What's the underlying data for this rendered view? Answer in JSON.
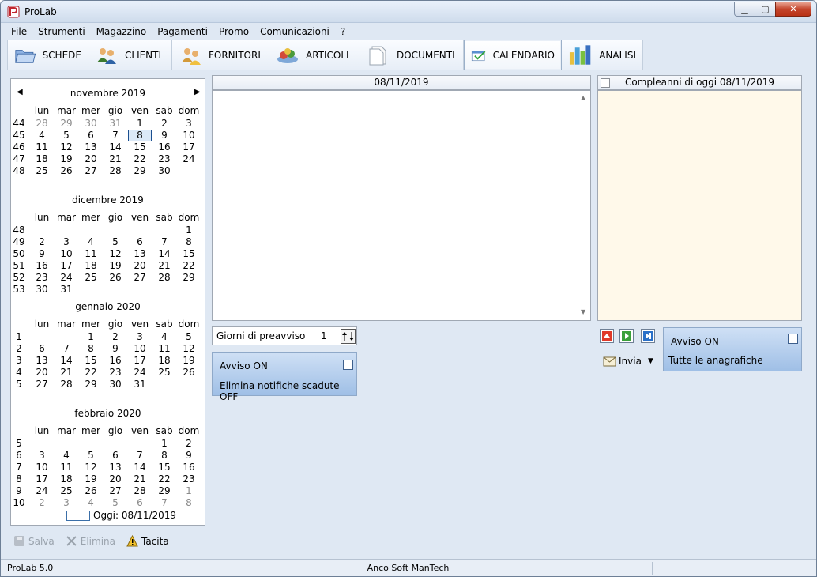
{
  "window": {
    "title": "ProLab"
  },
  "menu": [
    {
      "label": "File"
    },
    {
      "label": "Strumenti"
    },
    {
      "label": "Magazzino"
    },
    {
      "label": "Pagamenti"
    },
    {
      "label": "Promo"
    },
    {
      "label": "Comunicazioni"
    },
    {
      "label": "?"
    }
  ],
  "toolbar": [
    {
      "label": "SCHEDE",
      "icon": "folder-icon"
    },
    {
      "label": "CLIENTI",
      "icon": "customers-icon"
    },
    {
      "label": "FORNITORI",
      "icon": "suppliers-icon"
    },
    {
      "label": "ARTICOLI",
      "icon": "articles-icon"
    },
    {
      "label": "DOCUMENTI",
      "icon": "documents-icon"
    },
    {
      "label": "CALENDARIO",
      "icon": "calendar-check-icon",
      "active": true
    },
    {
      "label": "ANALISI",
      "icon": "bar-chart-icon"
    }
  ],
  "calendar": {
    "dow": [
      "lun",
      "mar",
      "mer",
      "gio",
      "ven",
      "sab",
      "dom"
    ],
    "selected": "8",
    "months": [
      {
        "title": "novembre 2019",
        "weeks": [
          {
            "wk": "44",
            "days": [
              [
                "28",
                1
              ],
              [
                "29",
                1
              ],
              [
                "30",
                1
              ],
              [
                "31",
                1
              ],
              [
                "1",
                0
              ],
              [
                "2",
                0
              ],
              [
                "3",
                0
              ]
            ]
          },
          {
            "wk": "45",
            "days": [
              [
                "4",
                0
              ],
              [
                "5",
                0
              ],
              [
                "6",
                0
              ],
              [
                "7",
                0
              ],
              [
                "8",
                0,
                "sel"
              ],
              [
                "9",
                0
              ],
              [
                "10",
                0
              ]
            ]
          },
          {
            "wk": "46",
            "days": [
              [
                "11",
                0
              ],
              [
                "12",
                0
              ],
              [
                "13",
                0
              ],
              [
                "14",
                0
              ],
              [
                "15",
                0
              ],
              [
                "16",
                0
              ],
              [
                "17",
                0
              ]
            ]
          },
          {
            "wk": "47",
            "days": [
              [
                "18",
                0
              ],
              [
                "19",
                0
              ],
              [
                "20",
                0
              ],
              [
                "21",
                0
              ],
              [
                "22",
                0
              ],
              [
                "23",
                0
              ],
              [
                "24",
                0
              ]
            ]
          },
          {
            "wk": "48",
            "days": [
              [
                "25",
                0
              ],
              [
                "26",
                0
              ],
              [
                "27",
                0
              ],
              [
                "28",
                0
              ],
              [
                "29",
                0
              ],
              [
                "30",
                0
              ],
              [
                "",
                0
              ]
            ]
          }
        ]
      },
      {
        "title": "dicembre 2019",
        "weeks": [
          {
            "wk": "48",
            "days": [
              [
                "",
                0
              ],
              [
                "",
                0
              ],
              [
                "",
                0
              ],
              [
                "",
                0
              ],
              [
                "",
                0
              ],
              [
                "",
                0
              ],
              [
                "1",
                0
              ]
            ]
          },
          {
            "wk": "49",
            "days": [
              [
                "2",
                0
              ],
              [
                "3",
                0
              ],
              [
                "4",
                0
              ],
              [
                "5",
                0
              ],
              [
                "6",
                0
              ],
              [
                "7",
                0
              ],
              [
                "8",
                0
              ]
            ]
          },
          {
            "wk": "50",
            "days": [
              [
                "9",
                0
              ],
              [
                "10",
                0
              ],
              [
                "11",
                0
              ],
              [
                "12",
                0
              ],
              [
                "13",
                0
              ],
              [
                "14",
                0
              ],
              [
                "15",
                0
              ]
            ]
          },
          {
            "wk": "51",
            "days": [
              [
                "16",
                0
              ],
              [
                "17",
                0
              ],
              [
                "18",
                0
              ],
              [
                "19",
                0
              ],
              [
                "20",
                0
              ],
              [
                "21",
                0
              ],
              [
                "22",
                0
              ]
            ]
          },
          {
            "wk": "52",
            "days": [
              [
                "23",
                0
              ],
              [
                "24",
                0
              ],
              [
                "25",
                0
              ],
              [
                "26",
                0
              ],
              [
                "27",
                0
              ],
              [
                "28",
                0
              ],
              [
                "29",
                0
              ]
            ]
          },
          {
            "wk": "53",
            "days": [
              [
                "30",
                0
              ],
              [
                "31",
                0
              ],
              [
                "",
                0
              ],
              [
                "",
                0
              ],
              [
                "",
                0
              ],
              [
                "",
                0
              ],
              [
                "",
                0
              ]
            ]
          }
        ]
      },
      {
        "title": "gennaio 2020",
        "weeks": [
          {
            "wk": "1",
            "days": [
              [
                "",
                0
              ],
              [
                "",
                0
              ],
              [
                "1",
                0
              ],
              [
                "2",
                0
              ],
              [
                "3",
                0
              ],
              [
                "4",
                0
              ],
              [
                "5",
                0
              ]
            ]
          },
          {
            "wk": "2",
            "days": [
              [
                "6",
                0
              ],
              [
                "7",
                0
              ],
              [
                "8",
                0
              ],
              [
                "9",
                0
              ],
              [
                "10",
                0
              ],
              [
                "11",
                0
              ],
              [
                "12",
                0
              ]
            ]
          },
          {
            "wk": "3",
            "days": [
              [
                "13",
                0
              ],
              [
                "14",
                0
              ],
              [
                "15",
                0
              ],
              [
                "16",
                0
              ],
              [
                "17",
                0
              ],
              [
                "18",
                0
              ],
              [
                "19",
                0
              ]
            ]
          },
          {
            "wk": "4",
            "days": [
              [
                "20",
                0
              ],
              [
                "21",
                0
              ],
              [
                "22",
                0
              ],
              [
                "23",
                0
              ],
              [
                "24",
                0
              ],
              [
                "25",
                0
              ],
              [
                "26",
                0
              ]
            ]
          },
          {
            "wk": "5",
            "days": [
              [
                "27",
                0
              ],
              [
                "28",
                0
              ],
              [
                "29",
                0
              ],
              [
                "30",
                0
              ],
              [
                "31",
                0
              ],
              [
                "",
                0
              ],
              [
                "",
                0
              ]
            ]
          }
        ]
      },
      {
        "title": "febbraio 2020",
        "weeks": [
          {
            "wk": "5",
            "days": [
              [
                "",
                0
              ],
              [
                "",
                0
              ],
              [
                "",
                0
              ],
              [
                "",
                0
              ],
              [
                "",
                0
              ],
              [
                "1",
                0
              ],
              [
                "2",
                0
              ]
            ]
          },
          {
            "wk": "6",
            "days": [
              [
                "3",
                0
              ],
              [
                "4",
                0
              ],
              [
                "5",
                0
              ],
              [
                "6",
                0
              ],
              [
                "7",
                0
              ],
              [
                "8",
                0
              ],
              [
                "9",
                0
              ]
            ]
          },
          {
            "wk": "7",
            "days": [
              [
                "10",
                0
              ],
              [
                "11",
                0
              ],
              [
                "12",
                0
              ],
              [
                "13",
                0
              ],
              [
                "14",
                0
              ],
              [
                "15",
                0
              ],
              [
                "16",
                0
              ]
            ]
          },
          {
            "wk": "8",
            "days": [
              [
                "17",
                0
              ],
              [
                "18",
                0
              ],
              [
                "19",
                0
              ],
              [
                "20",
                0
              ],
              [
                "21",
                0
              ],
              [
                "22",
                0
              ],
              [
                "23",
                0
              ]
            ]
          },
          {
            "wk": "9",
            "days": [
              [
                "24",
                0
              ],
              [
                "25",
                0
              ],
              [
                "26",
                0
              ],
              [
                "27",
                0
              ],
              [
                "28",
                0
              ],
              [
                "29",
                0
              ],
              [
                "1",
                1
              ]
            ]
          },
          {
            "wk": "10",
            "days": [
              [
                "2",
                1
              ],
              [
                "3",
                1
              ],
              [
                "4",
                1
              ],
              [
                "5",
                1
              ],
              [
                "6",
                1
              ],
              [
                "7",
                1
              ],
              [
                "8",
                1
              ]
            ]
          }
        ]
      }
    ],
    "today_label": "Oggi: 08/11/2019"
  },
  "events": {
    "header": "08/11/2019"
  },
  "notice": {
    "label": "Giorni di preavviso",
    "value": "1"
  },
  "left_card": {
    "line1": "Avviso ON",
    "line2": "Elimina notifiche scadute OFF"
  },
  "birthdays": {
    "header": "Compleanni di oggi 08/11/2019"
  },
  "right_card": {
    "line1": "Avviso ON",
    "line2": "Tutte le anagrafiche"
  },
  "send": {
    "label": "Invia"
  },
  "actions": {
    "save": "Salva",
    "delete": "Elimina",
    "mute": "Tacita"
  },
  "status": {
    "left": "ProLab 5.0",
    "center": "Anco Soft ManTech"
  },
  "colors": {
    "birthday_bg": "#fff9ea",
    "card_top": "#cfe0f5",
    "card_bottom": "#9fbfe6"
  }
}
